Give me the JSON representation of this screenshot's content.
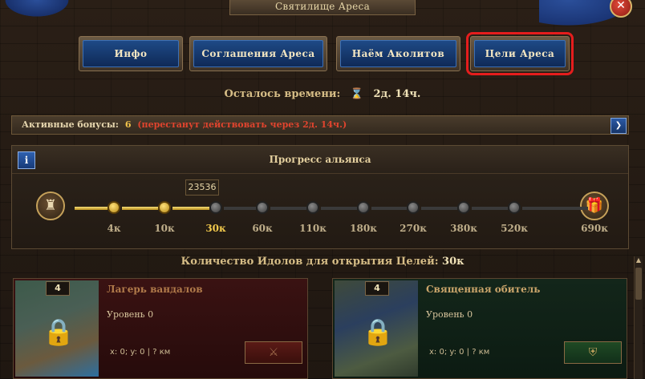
{
  "window": {
    "title": "Святилище Ареса",
    "close_icon": "close-icon"
  },
  "tabs": [
    {
      "label": "Инфо",
      "active": false
    },
    {
      "label": "Соглашения Ареса",
      "active": false
    },
    {
      "label": "Наём Аколитов",
      "active": false
    },
    {
      "label": "Цели Ареса",
      "active": true
    }
  ],
  "time_remaining": {
    "label": "Осталось времени:",
    "value": "2д. 14ч."
  },
  "bonuses": {
    "label": "Активные бонусы:",
    "count": "6",
    "warning": "(перестанут действовать через 2д. 14ч.)"
  },
  "progress": {
    "title": "Прогресс альянса",
    "info_label": "i",
    "current_value": "23536",
    "milestones": [
      "4к",
      "10к",
      "30к",
      "60к",
      "110к",
      "180к",
      "270к",
      "380к",
      "520к",
      "690к"
    ],
    "completed_count": 2,
    "current_index": 2
  },
  "idols": {
    "label": "Количество Идолов для открытия Целей:",
    "value": "30к"
  },
  "targets": [
    {
      "badge": "4",
      "title": "Лагерь вандалов",
      "level": "Уровень 0",
      "coords": "x: 0; y: 0 | ? км",
      "theme": "red"
    },
    {
      "badge": "4",
      "title": "Священная обитель",
      "level": "Уровень 0",
      "coords": "x: 0; y: 0 | ? км",
      "theme": "green"
    }
  ],
  "accent_colors": {
    "active_outline": "#e51d1d",
    "warning": "#e0442e",
    "gold": "#f2c94c"
  }
}
